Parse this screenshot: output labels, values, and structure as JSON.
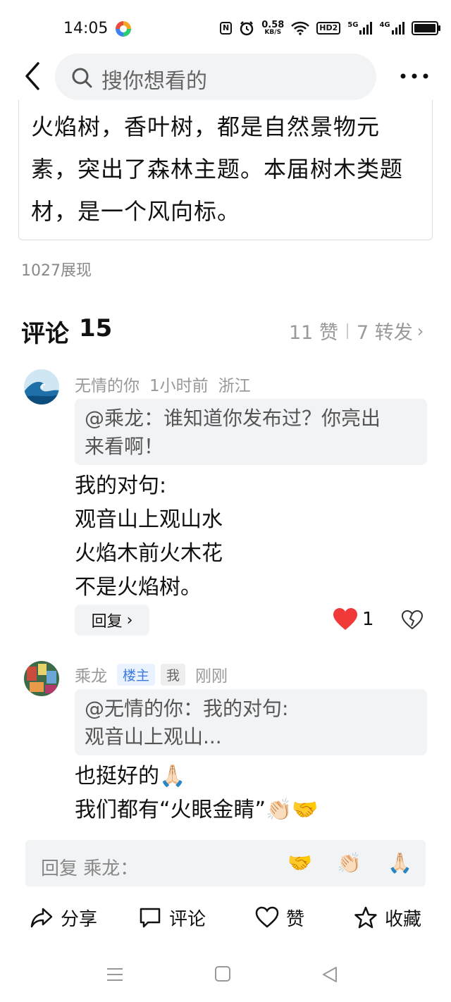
{
  "status_bar": {
    "time": "14:05",
    "nfc": "N",
    "net_speed_value": "0.58",
    "net_speed_unit": "KB/S",
    "hd": "HD2",
    "sim1": "5G",
    "sim2": "4G"
  },
  "header": {
    "search_placeholder": "搜你想看的"
  },
  "article": {
    "lines": [
      "火焰树，香叶树，都是自然景物元",
      "素，突出了森林主题。本届树木类题",
      "材，是一个风向标。"
    ],
    "views": "1027展现"
  },
  "comments_header": {
    "title": "评论",
    "count": "15",
    "likes": "11 赞",
    "reposts": "7 转发"
  },
  "comments": [
    {
      "author": "无情的你",
      "time": "1小时前",
      "location": "浙江",
      "quote_lines": [
        "@乘龙：谁知道你发布过？你亮出",
        "来看啊！"
      ],
      "body_lines": [
        "我的对句:",
        "观音山上观山水",
        "火焰木前火木花",
        "不是火焰树。"
      ],
      "reply_label": "回复",
      "like_count": "1"
    },
    {
      "author": "乘龙",
      "tag_owner": "楼主",
      "tag_me": "我",
      "time": "刚刚",
      "quote_lines": [
        "@无情的你：我的对句:",
        "观音山上观山..."
      ],
      "body_lines": [
        "也挺好的🙏🏻",
        "我们都有“火眼金睛”👏🏻🤝"
      ]
    }
  ],
  "reply_box": {
    "placeholder": "回复 乘龙：",
    "quick_emojis": [
      "🤝",
      "👏🏻",
      "🙏🏻"
    ]
  },
  "bottom_actions": {
    "share": "分享",
    "comment": "评论",
    "like": "赞",
    "favorite": "收藏"
  },
  "colors": {
    "like_red": "#f03a3a",
    "owner_tag_blue": "#3b7be0",
    "muted_gray": "#999999"
  }
}
